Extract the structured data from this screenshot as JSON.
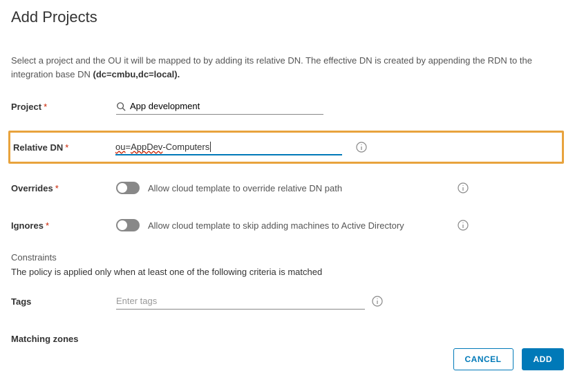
{
  "title": "Add Projects",
  "description_prefix": "Select a project and the OU it will be mapped to by adding its relative DN. The effective DN is created by appending the RDN to the integration base DN ",
  "description_bold": "(dc=cmbu,dc=local).",
  "labels": {
    "project": "Project",
    "relative_dn": "Relative DN",
    "overrides": "Overrides",
    "ignores": "Ignores",
    "tags": "Tags",
    "matching_zones": "Matching zones"
  },
  "fields": {
    "project_value": "App development",
    "relative_dn_value": "ou=AppDev-Computers",
    "overrides_text": "Allow cloud template to override relative DN path",
    "ignores_text": "Allow cloud template to skip adding machines to Active Directory",
    "tags_placeholder": "Enter tags",
    "overrides_on": false,
    "ignores_on": false
  },
  "constraints": {
    "heading": "Constraints",
    "desc": "The policy is applied only when at least one of the following criteria is matched"
  },
  "buttons": {
    "cancel": "CANCEL",
    "add": "ADD"
  },
  "colors": {
    "accent": "#0079b8",
    "highlight_border": "#e8a33d",
    "required": "#c92100"
  }
}
